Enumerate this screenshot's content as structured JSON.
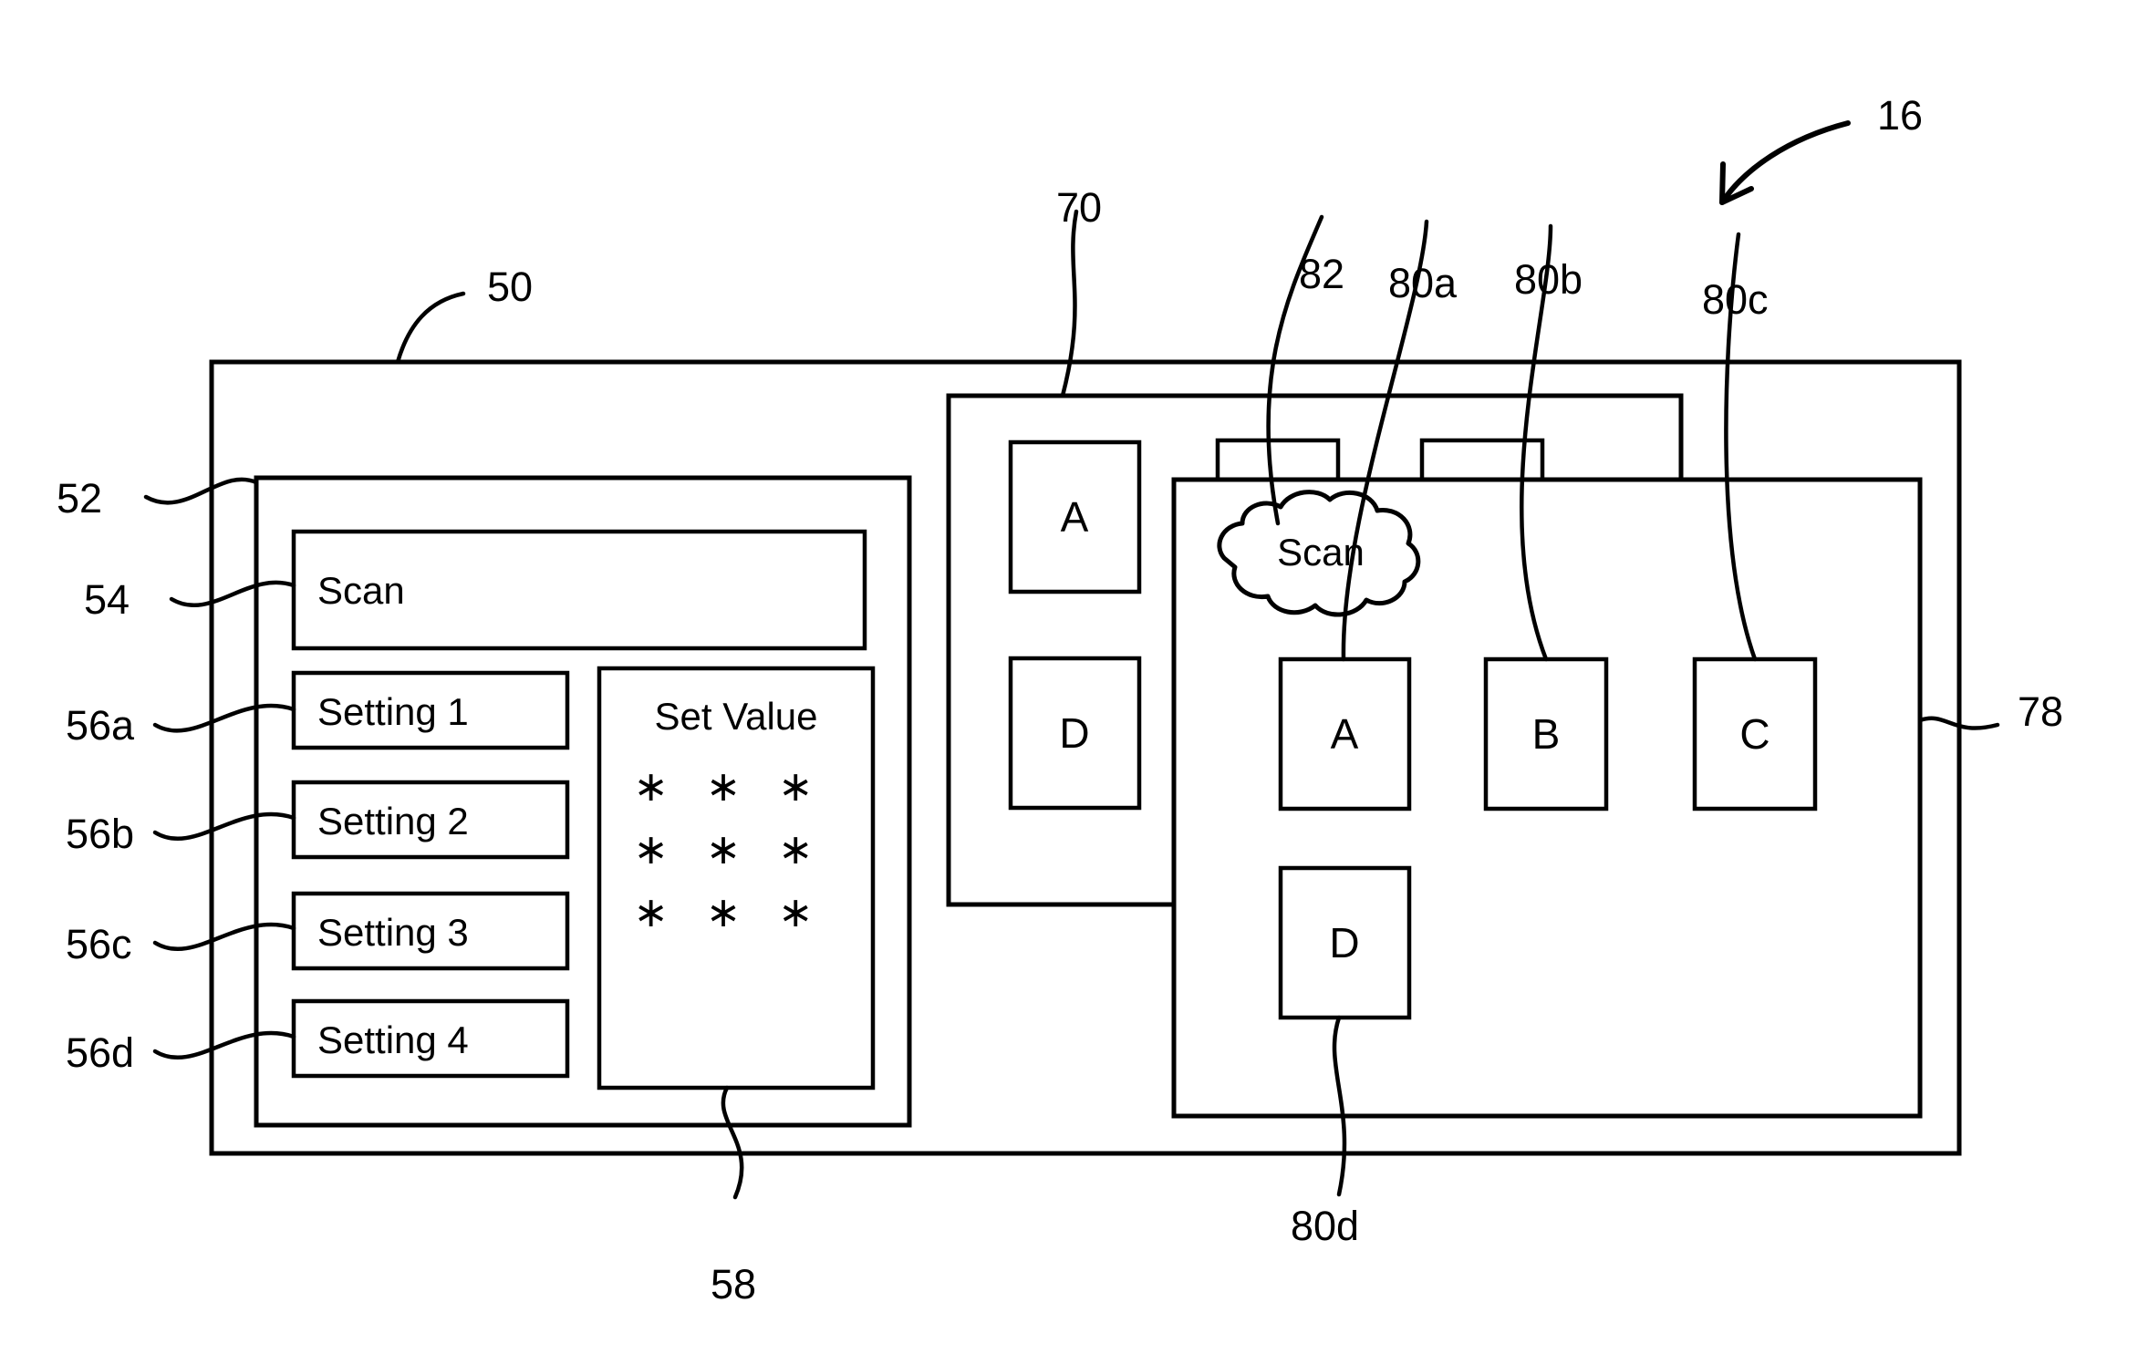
{
  "figure": {
    "title": "Patent figure: scanner operation panel and network device tree",
    "pointer_ref": "16"
  },
  "reference_numerals": {
    "outer_frame": "50",
    "left_panel": "52",
    "scan_header_button": "54",
    "setting_1": "56a",
    "setting_2": "56b",
    "setting_3": "56c",
    "setting_4": "56d",
    "set_value_box": "58",
    "tree_panel": "70",
    "device_panel": "78",
    "node_a": "80a",
    "node_b": "80b",
    "node_c": "80c",
    "node_d": "80d",
    "scan_cloud": "82",
    "device_pointer": "16"
  },
  "left_panel": {
    "header_button": "Scan",
    "settings": [
      "Setting 1",
      "Setting 2",
      "Setting 3",
      "Setting 4"
    ],
    "set_value": {
      "title": "Set Value",
      "rows": [
        "∗ ∗ ∗",
        "∗ ∗ ∗",
        "∗ ∗ ∗"
      ]
    }
  },
  "tree_panel": {
    "nodes": [
      "A",
      "D"
    ]
  },
  "device_panel": {
    "cloud_label": "Scan",
    "nodes": [
      "A",
      "B",
      "C",
      "D"
    ]
  },
  "colors": {
    "ink": "#000000",
    "paper": "#ffffff"
  }
}
